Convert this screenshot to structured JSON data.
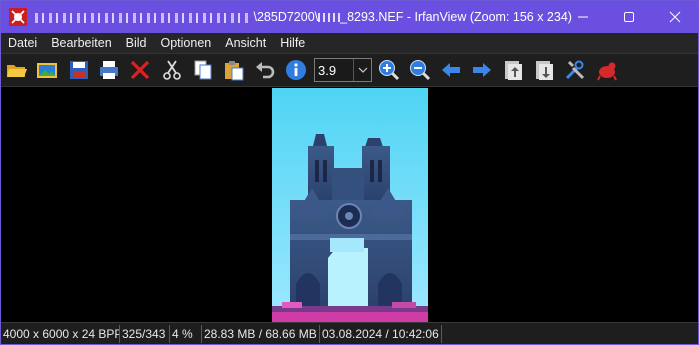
{
  "titlebar": {
    "title_visible": "\\285D7200\\",
    "title_file": "_8293.NEF - IrfanView (Zoom: 156 x 234)",
    "minimize": "—",
    "maximize": "☐",
    "close": "✕"
  },
  "menu": [
    "Datei",
    "Bearbeiten",
    "Bild",
    "Optionen",
    "Ansicht",
    "Hilfe"
  ],
  "toolbar": {
    "zoom_value": "3.9",
    "icons": [
      "open-folder",
      "slideshow",
      "save",
      "print",
      "delete",
      "cut",
      "copy",
      "paste",
      "undo",
      "info",
      "zoom-in",
      "zoom-out",
      "previous",
      "next",
      "first",
      "last",
      "settings",
      "exit"
    ]
  },
  "status": {
    "dimensions": "4000 x 6000 x 24 BPP",
    "index": "325/343",
    "zoom_percent": "4 %",
    "file_size": "28.83 MB / 68.66 MB",
    "datetime": "03.08.2024 / 10:42:06"
  },
  "colors": {
    "titlebar": "#6a4fe0",
    "menubar": "#262626",
    "toolbar": "#1e1e1e",
    "canvas": "#000000"
  }
}
